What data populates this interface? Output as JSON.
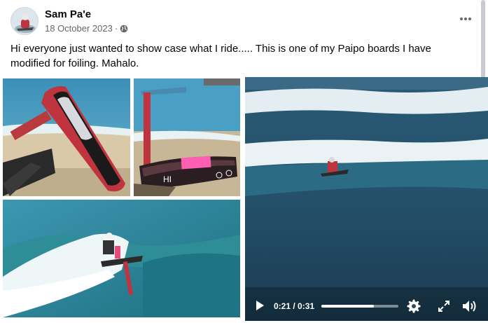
{
  "post": {
    "author": "Sam Pa'e",
    "date": "18 October 2023",
    "separator": "·",
    "caption": "Hi everyone just wanted to show case what I ride..... This is one of my Paipo boards I have modified for foiling. Mahalo."
  },
  "board_lettering": "HI",
  "icons": {
    "privacy": "globe-icon",
    "more": "more-dots-icon",
    "play": "play-icon",
    "settings": "gear-icon",
    "fullscreen": "expand-icon",
    "volume": "volume-icon"
  },
  "video": {
    "time": "0:21 / 0:31",
    "progress": 0.68
  },
  "colors": {
    "board_red": "#c0343f",
    "board_pink": "#ff5fb3",
    "water": "#2f7f9b"
  }
}
